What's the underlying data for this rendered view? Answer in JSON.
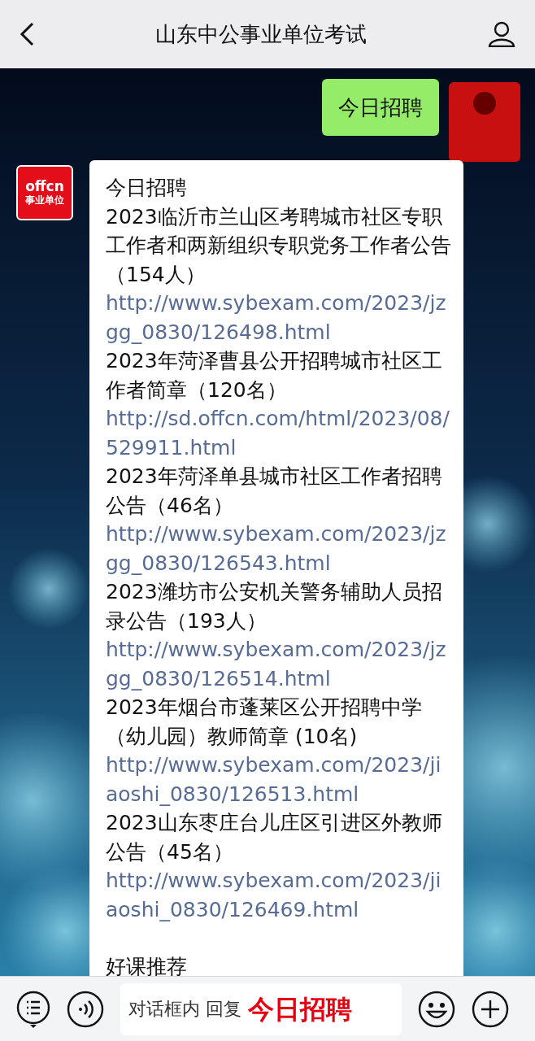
{
  "header": {
    "title": "山东中公事业单位考试"
  },
  "sent": {
    "text": "今日招聘"
  },
  "avatar": {
    "brand": "offcn",
    "caption": "事业单位"
  },
  "reply": {
    "heading": "今日招聘",
    "items": [
      {
        "title": "2023临沂市兰山区考聘城市社区专职工作者和两新组织专职党务工作者公告（154人）",
        "url": "http://www.sybexam.com/2023/jzgg_0830/126498.html"
      },
      {
        "title": "2023年菏泽曹县公开招聘城市社区工作者简章（120名）",
        "url": "http://sd.offcn.com/html/2023/08/529911.html"
      },
      {
        "title": "2023年菏泽单县城市社区工作者招聘公告（46名）",
        "url": "http://www.sybexam.com/2023/jzgg_0830/126543.html"
      },
      {
        "title": "2023潍坊市公安机关警务辅助人员招录公告（193人）",
        "url": "http://www.sybexam.com/2023/jzgg_0830/126514.html"
      },
      {
        "title": "2023年烟台市蓬莱区公开招聘中学（幼儿园）教师简章 (10名)",
        "url": "http://www.sybexam.com/2023/jiaoshi_0830/126513.html"
      },
      {
        "title": "2023山东枣庄台儿庄区引进区外教师公告（45名）",
        "url": "http://www.sybexam.com/2023/jiaoshi_0830/126469.html"
      }
    ],
    "footer": "好课推荐"
  },
  "bottom_bar": {
    "hint": "对话框内 回复",
    "keyword": "今日招聘"
  }
}
